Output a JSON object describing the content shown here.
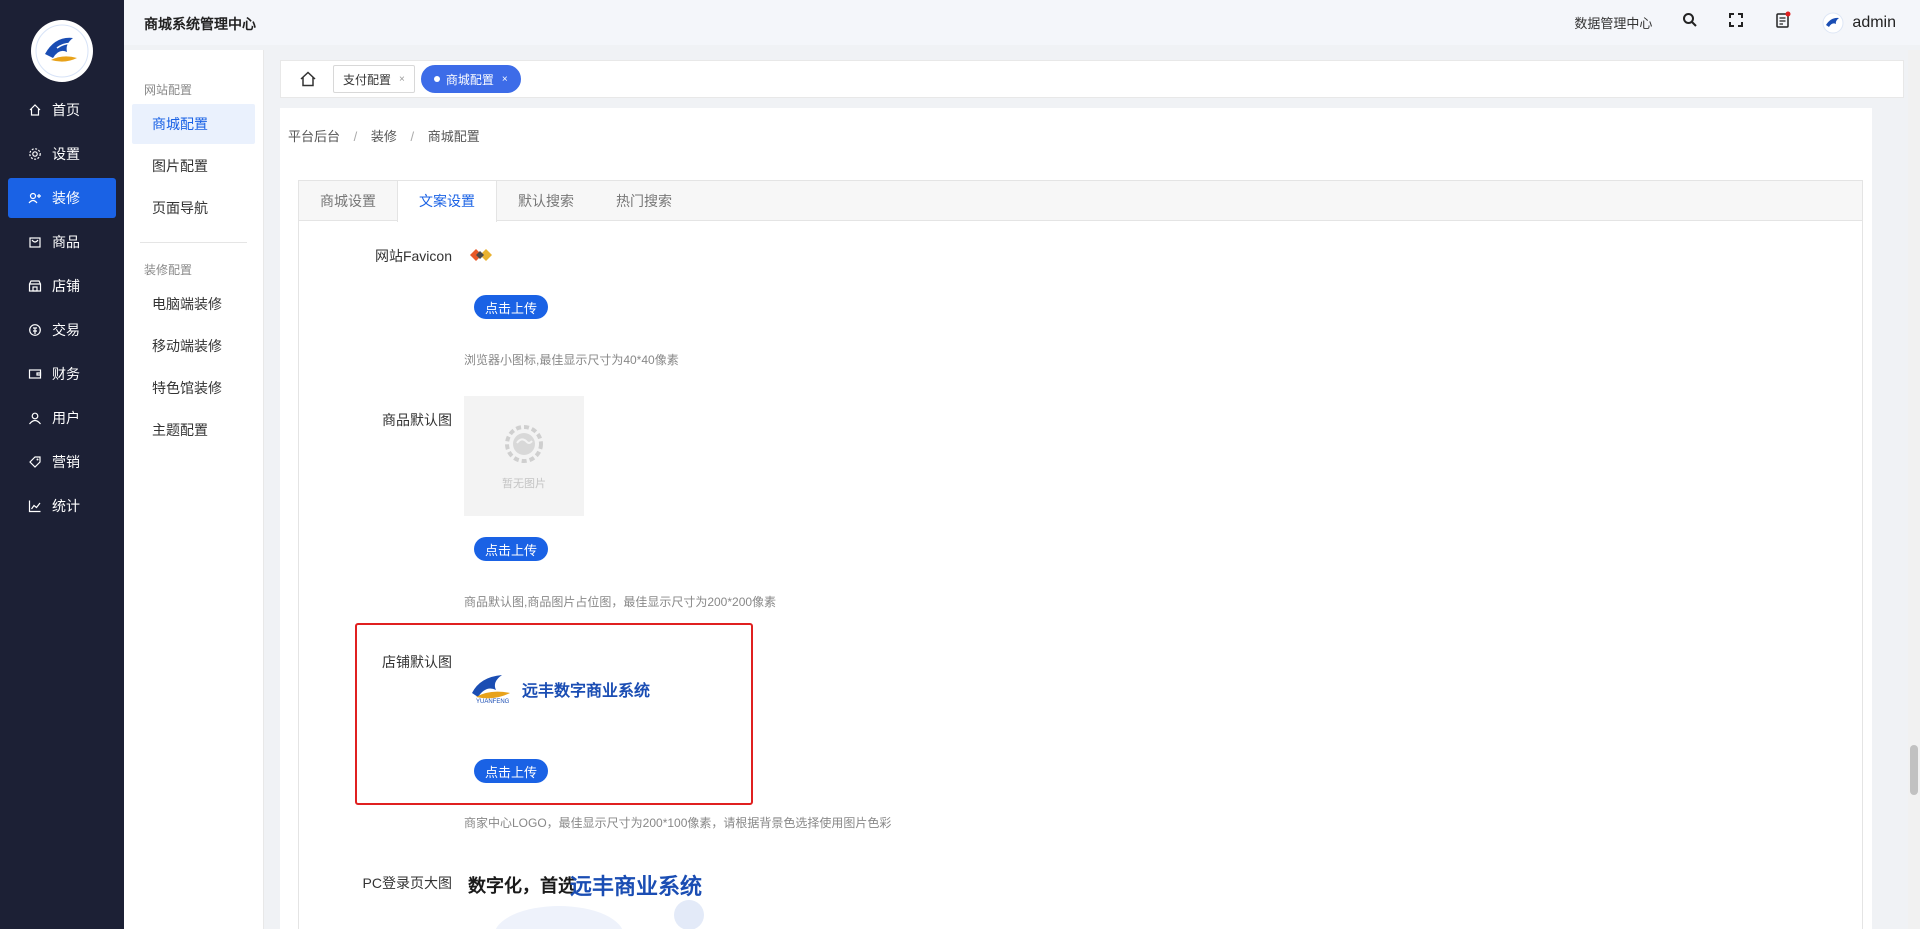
{
  "sidebar": {
    "items": [
      {
        "label": "首页",
        "icon": "home-icon"
      },
      {
        "label": "设置",
        "icon": "gear-icon"
      },
      {
        "label": "装修",
        "icon": "decorate-icon"
      },
      {
        "label": "商品",
        "icon": "goods-icon"
      },
      {
        "label": "店铺",
        "icon": "store-icon"
      },
      {
        "label": "交易",
        "icon": "trade-icon"
      },
      {
        "label": "财务",
        "icon": "wallet-icon"
      },
      {
        "label": "用户",
        "icon": "user-icon"
      },
      {
        "label": "营销",
        "icon": "tag-icon"
      },
      {
        "label": "统计",
        "icon": "chart-icon"
      }
    ],
    "active_index": 2
  },
  "submenu": {
    "group1": "网站配置",
    "group1_items": [
      "商城配置",
      "图片配置",
      "页面导航"
    ],
    "group2": "装修配置",
    "group2_items": [
      "电脑端装修",
      "移动端装修",
      "特色馆装修",
      "主题配置"
    ]
  },
  "header": {
    "title": "商城系统管理中心",
    "data_center": "数据管理中心",
    "username": "admin"
  },
  "tabs": {
    "items": [
      {
        "label": "支付配置",
        "close": "×"
      },
      {
        "label": "商城配置",
        "close": "×"
      }
    ]
  },
  "breadcrumb": [
    "平台后台",
    "装修",
    "商城配置"
  ],
  "breadcrumb_sep": "/",
  "panel_tabs": [
    "商城设置",
    "文案设置",
    "默认搜索",
    "热门搜索"
  ],
  "form": {
    "favicon_label": "网站Favicon",
    "upload_label": "点击上传",
    "favicon_tip": "浏览器小图标,最佳显示尺寸为40*40像素",
    "goods_label": "商品默认图",
    "no_image_text": "暂无图片",
    "goods_tip": "商品默认图,商品图片占位图，最佳显示尺寸为200*200像素",
    "store_label": "店铺默认图",
    "store_logo_text": "远丰数字商业系统",
    "store_logo_sub": "YUANFENG",
    "store_tip": "商家中心LOGO，最佳显示尺寸为200*100像素，请根据背景色选择使用图片色彩",
    "pc_label": "PC登录页大图",
    "pc_banner_text1": "数字化，首选",
    "pc_banner_text2": "远丰商业系统"
  },
  "colors": {
    "accent": "#1a62e5",
    "sidebar_bg": "#1c2035",
    "highlight_border": "#e02020"
  }
}
